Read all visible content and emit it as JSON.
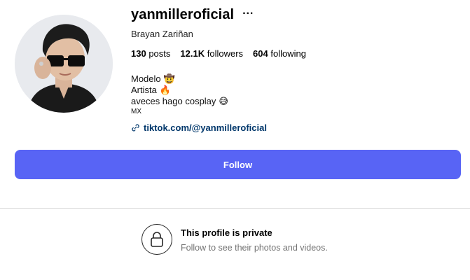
{
  "profile": {
    "username": "yanmilleroficial",
    "full_name": "Brayan Zariñan",
    "more_label": "···"
  },
  "stats": {
    "posts_count": "130",
    "posts_label": "posts",
    "followers_count": "12.1K",
    "followers_label": "followers",
    "following_count": "604",
    "following_label": "following"
  },
  "bio": {
    "line1": "Modelo",
    "line1_emoji": "🤠",
    "line2": "Artista",
    "line2_emoji": "🔥",
    "line3": "aveces hago cosplay",
    "line3_emoji": "😅",
    "country": "MX"
  },
  "link": {
    "text": "tiktok.com/@yanmilleroficial"
  },
  "actions": {
    "follow_label": "Follow"
  },
  "private": {
    "title": "This profile is private",
    "subtitle": "Follow to see their photos and videos."
  },
  "colors": {
    "follow_button": "#5864f5",
    "link": "#00376b"
  }
}
